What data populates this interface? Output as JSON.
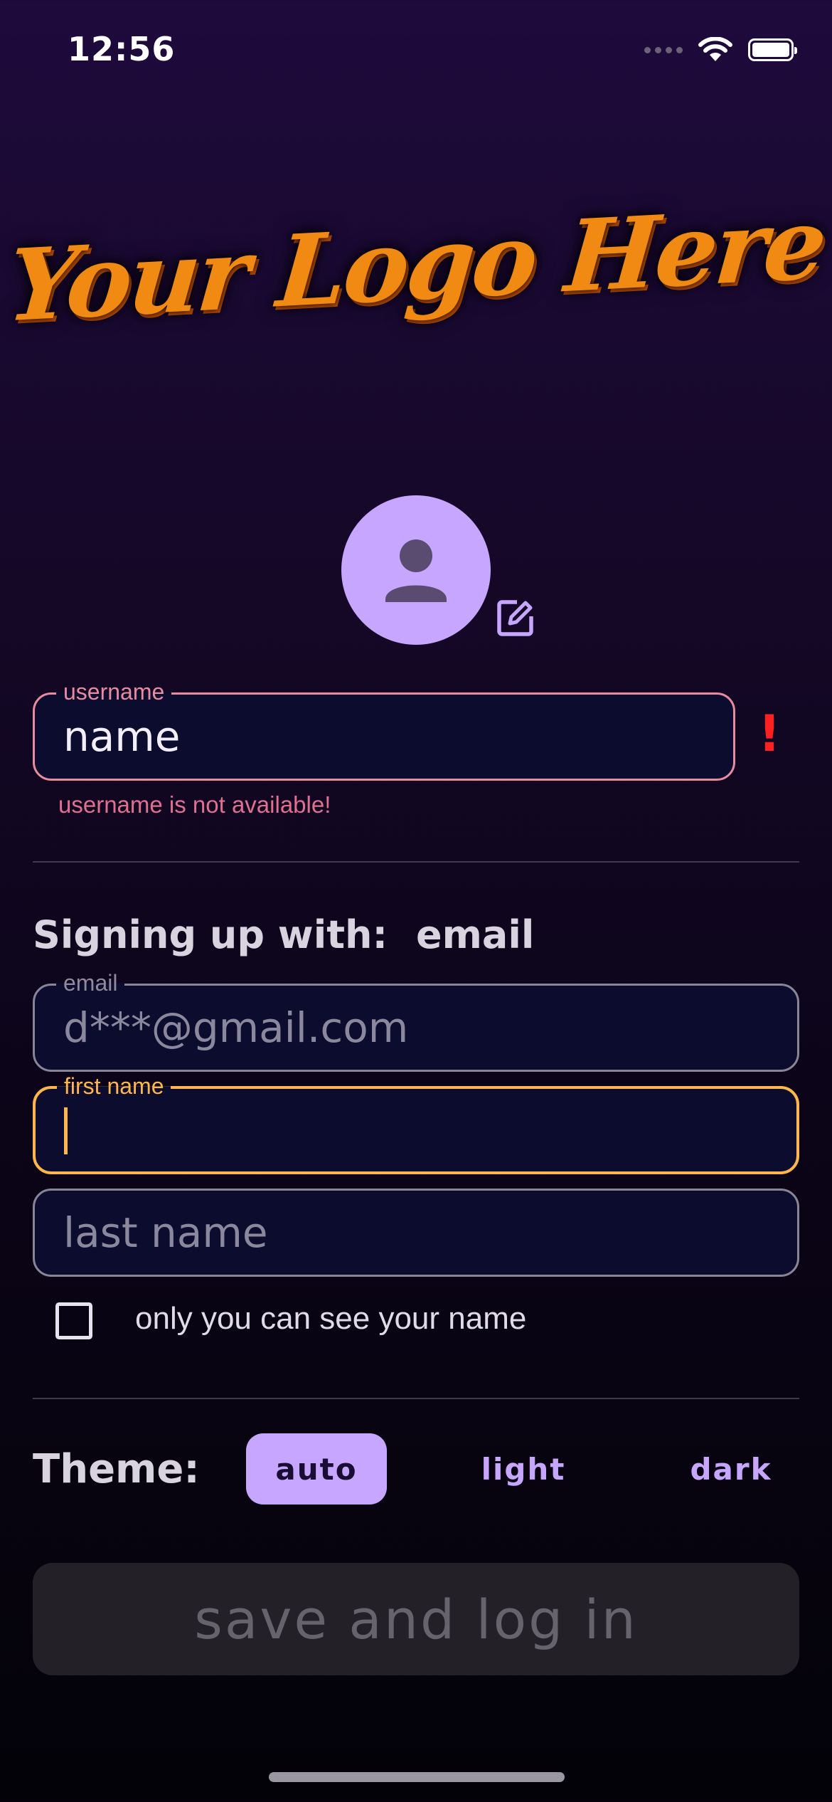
{
  "status_bar": {
    "time": "12:56"
  },
  "logo": {
    "text": "Your Logo Here"
  },
  "avatar": {
    "icon": "person-icon",
    "edit_icon": "edit-icon"
  },
  "username_field": {
    "label": "username",
    "value": "name",
    "error_mark": "!",
    "error": "username is not available!"
  },
  "signup": {
    "label": "Signing up with:",
    "method": "email"
  },
  "email_field": {
    "label": "email",
    "value": "d***@gmail.com"
  },
  "first_name_field": {
    "label": "first name",
    "value": ""
  },
  "last_name_field": {
    "placeholder": "last name"
  },
  "privacy": {
    "label": "only you can see your name",
    "checked": false
  },
  "theme": {
    "label": "Theme:",
    "options": [
      "auto",
      "light",
      "dark"
    ],
    "selected": "auto"
  },
  "save_button": {
    "label": "save and log in"
  },
  "colors": {
    "accent": "#c7a6ff",
    "error": "#e88ba0",
    "focus": "#ffb74d",
    "logo": "#f08a12"
  }
}
